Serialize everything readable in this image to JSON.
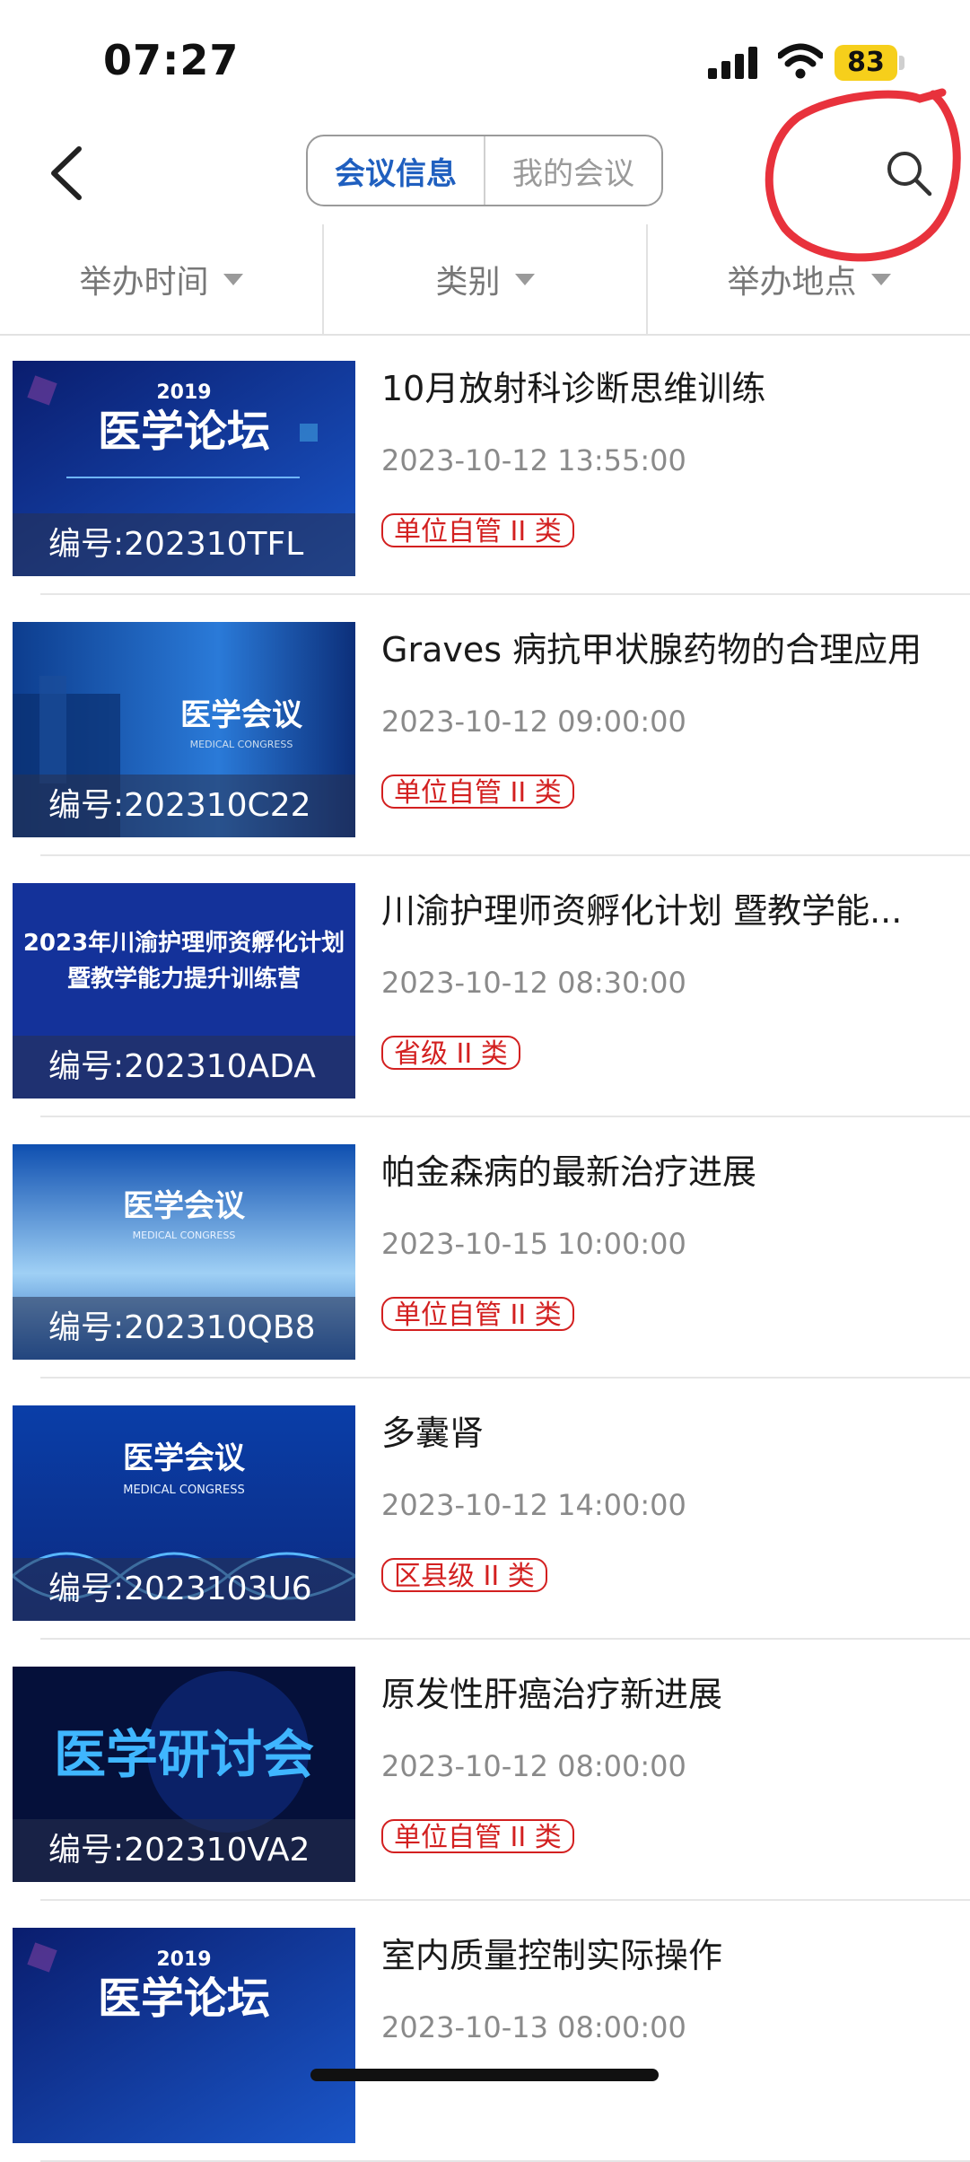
{
  "status_bar": {
    "time": "07:27",
    "battery": "83"
  },
  "nav": {
    "tabs": [
      {
        "label": "会议信息",
        "active": true
      },
      {
        "label": "我的会议",
        "active": false
      }
    ]
  },
  "filters": [
    {
      "label": "举办时间"
    },
    {
      "label": "类别"
    },
    {
      "label": "举办地点"
    }
  ],
  "meetings": [
    {
      "title": "10月放射科诊断思维训练",
      "date": "2023-10-12 13:55:00",
      "tag": "单位自管 II 类",
      "code": "编号:202310TFL",
      "banner": "医学论坛",
      "banner_sub": "2019"
    },
    {
      "title": "Graves 病抗甲状腺药物的合理应用",
      "date": "2023-10-12 09:00:00",
      "tag": "单位自管 II 类",
      "code": "编号:202310C22",
      "banner": "医学会议",
      "banner_sub": "MEDICAL CONGRESS"
    },
    {
      "title": "川渝护理师资孵化计划 暨教学能...",
      "date": "2023-10-12 08:30:00",
      "tag": "省级 II 类",
      "code": "编号:202310ADA",
      "banner": "2023年川渝护理师资孵化计划",
      "banner_sub": "暨教学能力提升训练营"
    },
    {
      "title": "帕金森病的最新治疗进展",
      "date": "2023-10-15 10:00:00",
      "tag": "单位自管 II 类",
      "code": "编号:202310QB8",
      "banner": "医学会议",
      "banner_sub": "MEDICAL CONGRESS"
    },
    {
      "title": "多囊肾",
      "date": "2023-10-12 14:00:00",
      "tag": "区县级 II 类",
      "code": "编号:2023103U6",
      "banner": "医学会议",
      "banner_sub": "MEDICAL CONGRESS"
    },
    {
      "title": "原发性肝癌治疗新进展",
      "date": "2023-10-12 08:00:00",
      "tag": "单位自管 II 类",
      "code": "编号:202310VA2",
      "banner": "医学研讨会",
      "banner_sub": ""
    },
    {
      "title": "室内质量控制实际操作",
      "date": "2023-10-13 08:00:00",
      "tag": "",
      "code": "",
      "banner": "医学论坛",
      "banner_sub": "2019"
    }
  ],
  "colors": {
    "accent": "#1f5fbf",
    "tag": "#d32020",
    "annotation": "#e8323c",
    "battery": "#f6cf1b"
  }
}
